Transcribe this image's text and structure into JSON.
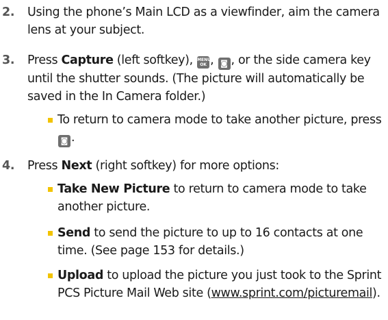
{
  "steps": [
    {
      "number": "2.",
      "text": "Using the phone’s Main LCD as a viewfinder, aim the camera lens at your subject."
    },
    {
      "number": "3.",
      "pre": "Press ",
      "bold": "Capture",
      "post_bold": " (left softkey), ",
      "sep1": ", ",
      "post_keys": ", or the side camera key until the shutter sounds. (The picture will automatically be saved in the In Camera folder.)",
      "bullet": {
        "text": "To return to camera mode to take another picture, press ",
        "end": "."
      }
    },
    {
      "number": "4.",
      "pre": "Press ",
      "bold": "Next",
      "post": " (right softkey) for more options:",
      "bullets": [
        {
          "bold": "Take New Picture",
          "text": " to return to camera mode to take another picture."
        },
        {
          "bold": "Send",
          "text": " to send the picture to up to 16 contacts at one time. (See page 153 for details.)"
        },
        {
          "bold": "Upload",
          "text": " to upload the picture you just took to the Sprint PCS Picture Mail Web site (",
          "link": "www.sprint.com/picturemail",
          "end": ")."
        }
      ]
    }
  ],
  "keys": {
    "menu_ok": {
      "line1": "MENU",
      "line2": "OK",
      "icon": "menu-ok-key-icon"
    },
    "camera": {
      "glyph": "◙",
      "icon": "camera-key-icon"
    }
  },
  "colors": {
    "bullet": "#f2c300",
    "key": "#6f6f6f",
    "number": "#555555"
  }
}
